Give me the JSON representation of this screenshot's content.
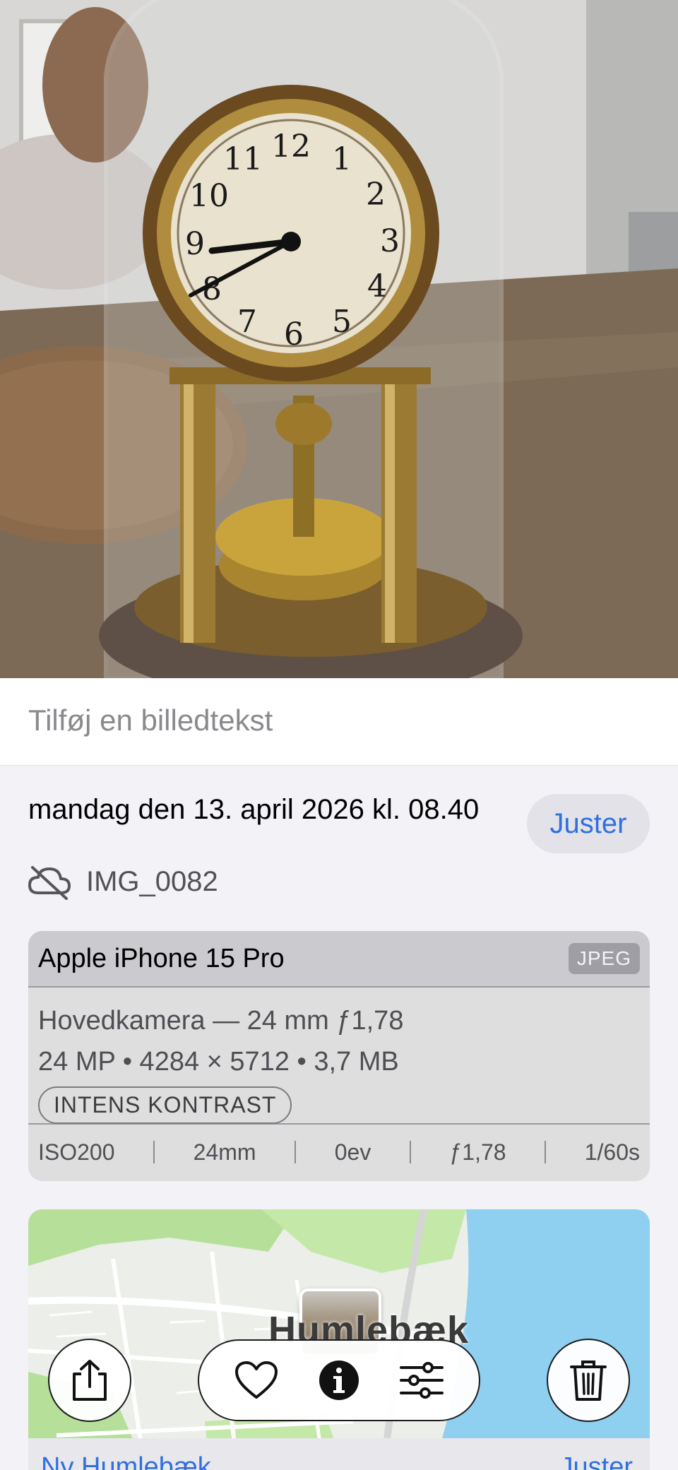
{
  "photo": {
    "subject_icon": "anniversary-clock-photo"
  },
  "caption": {
    "placeholder": "Tilføj en billedtekst",
    "value": ""
  },
  "date": {
    "text": "mandag den 13. april 2026 kl. 08.40",
    "adjust_label": "Juster"
  },
  "file": {
    "icon": "cloud-off-icon",
    "name": "IMG_0082"
  },
  "device": {
    "name": "Apple iPhone 15 Pro",
    "format": "JPEG",
    "lens": "Hovedkamera — 24 mm ƒ1,78",
    "specs": "24 MP • 4284 × 5712 • 3,7 MB",
    "style": "INTENS KONTRAST",
    "exif": [
      "ISO200",
      "24mm",
      "0ev",
      "ƒ1,78",
      "1/60s"
    ]
  },
  "map": {
    "city_label": "Humlebæk",
    "place_link": "Ny Humlebæk",
    "adjust_label": "Juster"
  },
  "toolbar": {
    "share_icon": "share-icon",
    "favorite_icon": "heart-icon",
    "info_icon": "info-icon",
    "edit_icon": "sliders-icon",
    "delete_icon": "trash-icon"
  },
  "colors": {
    "accent": "#2f6fe0",
    "background": "#f2f2f7",
    "water": "#8fcfef",
    "park": "#b6e09a"
  }
}
